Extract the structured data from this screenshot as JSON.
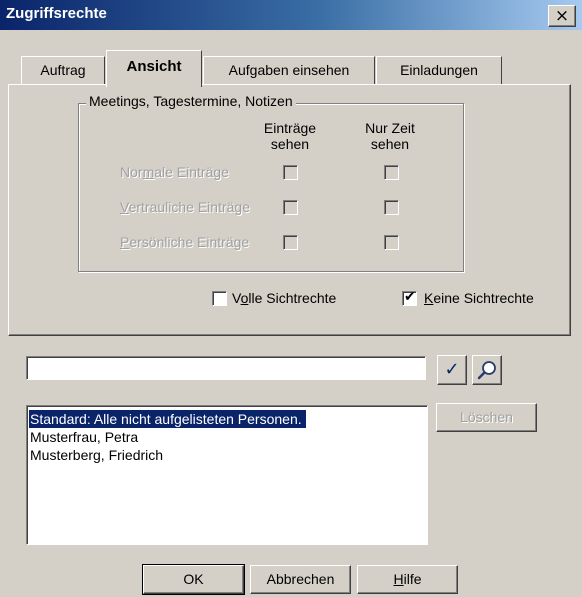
{
  "window": {
    "title": "Zugriffsrechte",
    "close_label": "×"
  },
  "tabs": [
    {
      "label": "Auftrag",
      "active": false
    },
    {
      "label": "Ansicht",
      "active": true
    },
    {
      "label": "Aufgaben einsehen",
      "active": false
    },
    {
      "label": "Einladungen",
      "active": false
    }
  ],
  "group": {
    "title": "Meetings, Tagestermine, Notizen",
    "col1_line1": "Einträge",
    "col1_line2": "sehen",
    "col2_line1": "Nur Zeit",
    "col2_line2": "sehen",
    "rows": [
      {
        "label_pre": "Nor",
        "label_acc": "m",
        "label_post": "ale Einträge"
      },
      {
        "label_pre": "",
        "label_acc": "V",
        "label_post": "ertrauliche Einträge"
      },
      {
        "label_pre": "",
        "label_acc": "P",
        "label_post": "ersönliche Einträge"
      }
    ]
  },
  "options": {
    "full_pre": "V",
    "full_acc": "o",
    "full_post": "lle Sichtrechte",
    "full_checked": false,
    "none_acc": "K",
    "none_post": "eine Sichtrechte",
    "none_checked": true,
    "check_mark": "✔"
  },
  "search": {
    "value": "",
    "confirm_icon": "✓"
  },
  "people": [
    "Standard: Alle nicht aufgelisteten Personen.",
    "Musterfrau, Petra",
    "Musterberg, Friedrich"
  ],
  "buttons": {
    "delete": "Löschen",
    "ok": "OK",
    "cancel": "Abbrechen",
    "help_acc": "H",
    "help_post": "ilfe"
  }
}
